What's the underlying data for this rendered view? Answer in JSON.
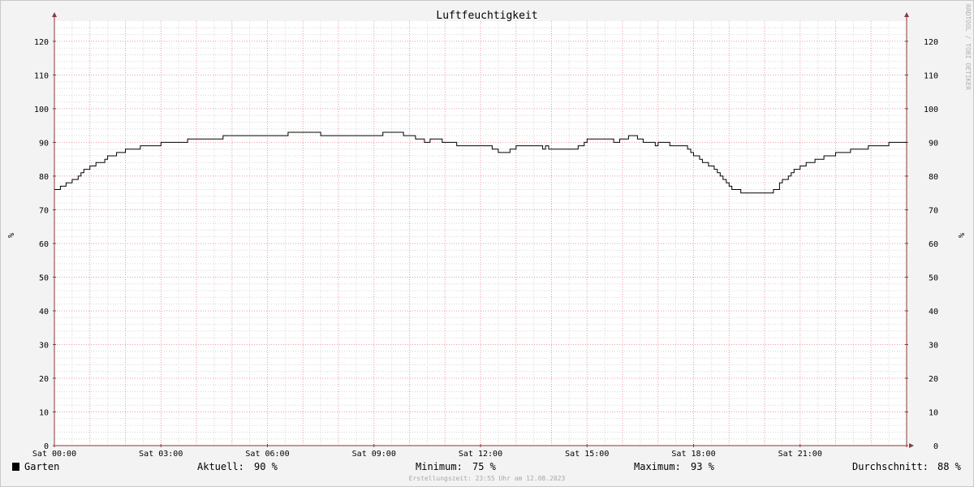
{
  "chart_data": {
    "type": "line",
    "title": "Luftfeuchtigkeit",
    "ylabel_left": "%",
    "ylabel_right": "%",
    "ylim": [
      0,
      126
    ],
    "ytick_values": [
      0,
      10,
      20,
      30,
      40,
      50,
      60,
      70,
      80,
      90,
      100,
      110,
      120
    ],
    "ytick_labels": [
      "0",
      "10",
      "20",
      "30",
      "40",
      "50",
      "60",
      "70",
      "80",
      "90",
      "100",
      "110",
      "120"
    ],
    "xlim_hours": [
      0,
      24
    ],
    "xtick_hours": [
      0,
      3,
      6,
      9,
      12,
      15,
      18,
      21
    ],
    "xtick_labels": [
      "Sat 00:00",
      "Sat 03:00",
      "Sat 06:00",
      "Sat 09:00",
      "Sat 12:00",
      "Sat 15:00",
      "Sat 18:00",
      "Sat 21:00"
    ],
    "grid": true,
    "series": [
      {
        "name": "Garten",
        "color": "#000000",
        "step": true,
        "points": [
          [
            0.0,
            76
          ],
          [
            0.17,
            77
          ],
          [
            0.33,
            78
          ],
          [
            0.5,
            79
          ],
          [
            0.67,
            80
          ],
          [
            0.75,
            81
          ],
          [
            0.83,
            82
          ],
          [
            1.0,
            83
          ],
          [
            1.17,
            84
          ],
          [
            1.42,
            85
          ],
          [
            1.5,
            86
          ],
          [
            1.75,
            87
          ],
          [
            2.0,
            88
          ],
          [
            2.42,
            89
          ],
          [
            3.0,
            90
          ],
          [
            3.75,
            91
          ],
          [
            4.75,
            92
          ],
          [
            6.58,
            93
          ],
          [
            7.5,
            92
          ],
          [
            9.25,
            93
          ],
          [
            9.83,
            92
          ],
          [
            10.17,
            91
          ],
          [
            10.42,
            90
          ],
          [
            10.58,
            91
          ],
          [
            10.92,
            90
          ],
          [
            11.33,
            89
          ],
          [
            12.33,
            88
          ],
          [
            12.5,
            87
          ],
          [
            12.83,
            88
          ],
          [
            13.0,
            89
          ],
          [
            13.75,
            88
          ],
          [
            13.83,
            89
          ],
          [
            13.92,
            88
          ],
          [
            14.75,
            89
          ],
          [
            14.92,
            90
          ],
          [
            15.0,
            91
          ],
          [
            15.75,
            90
          ],
          [
            15.92,
            91
          ],
          [
            16.17,
            92
          ],
          [
            16.42,
            91
          ],
          [
            16.58,
            90
          ],
          [
            16.92,
            89
          ],
          [
            17.0,
            90
          ],
          [
            17.33,
            89
          ],
          [
            17.83,
            88
          ],
          [
            17.92,
            87
          ],
          [
            18.0,
            86
          ],
          [
            18.17,
            85
          ],
          [
            18.25,
            84
          ],
          [
            18.42,
            83
          ],
          [
            18.58,
            82
          ],
          [
            18.67,
            81
          ],
          [
            18.75,
            80
          ],
          [
            18.83,
            79
          ],
          [
            18.92,
            78
          ],
          [
            19.0,
            77
          ],
          [
            19.08,
            76
          ],
          [
            19.33,
            75
          ],
          [
            20.25,
            76
          ],
          [
            20.42,
            78
          ],
          [
            20.5,
            79
          ],
          [
            20.67,
            80
          ],
          [
            20.75,
            81
          ],
          [
            20.83,
            82
          ],
          [
            21.0,
            83
          ],
          [
            21.17,
            84
          ],
          [
            21.42,
            85
          ],
          [
            21.67,
            86
          ],
          [
            22.0,
            87
          ],
          [
            22.42,
            88
          ],
          [
            22.92,
            89
          ],
          [
            23.5,
            90
          ],
          [
            24.0,
            90
          ]
        ]
      }
    ]
  },
  "legend": {
    "series_name": "Garten",
    "swatch_color": "#000000",
    "aktuell_label": "Aktuell:",
    "aktuell_value": "90 %",
    "minimum_label": "Minimum:",
    "minimum_value": "75 %",
    "maximum_label": "Maximum:",
    "maximum_value": "93 %",
    "durchschnitt_label": "Durchschnitt:",
    "durchschnitt_value": "88 %"
  },
  "footer": "Erstellungszeit: 23:55 Uhr am 12.08.2023",
  "watermark": "RRDTOOL / TOBI OETIKER",
  "colors": {
    "background": "#f3f3f3",
    "plot_background": "#ffffff",
    "major_grid": "#e89aa0",
    "minor_grid": "#d6d6d6",
    "axis": "#8b3a3a"
  }
}
